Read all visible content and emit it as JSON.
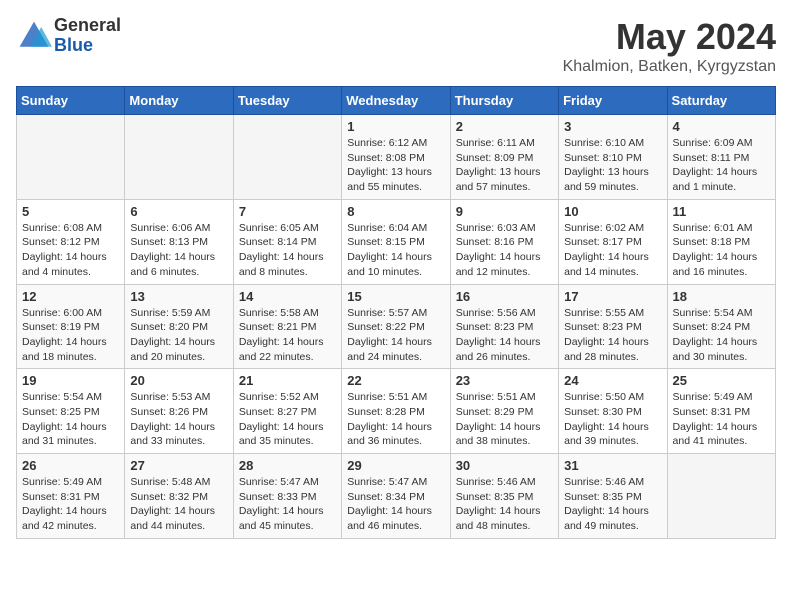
{
  "logo": {
    "general": "General",
    "blue": "Blue"
  },
  "title": {
    "month": "May 2024",
    "location": "Khalmion, Batken, Kyrgyzstan"
  },
  "days": [
    "Sunday",
    "Monday",
    "Tuesday",
    "Wednesday",
    "Thursday",
    "Friday",
    "Saturday"
  ],
  "weeks": [
    [
      {
        "date": "",
        "info": ""
      },
      {
        "date": "",
        "info": ""
      },
      {
        "date": "",
        "info": ""
      },
      {
        "date": "1",
        "info": "Sunrise: 6:12 AM\nSunset: 8:08 PM\nDaylight: 13 hours and 55 minutes."
      },
      {
        "date": "2",
        "info": "Sunrise: 6:11 AM\nSunset: 8:09 PM\nDaylight: 13 hours and 57 minutes."
      },
      {
        "date": "3",
        "info": "Sunrise: 6:10 AM\nSunset: 8:10 PM\nDaylight: 13 hours and 59 minutes."
      },
      {
        "date": "4",
        "info": "Sunrise: 6:09 AM\nSunset: 8:11 PM\nDaylight: 14 hours and 1 minute."
      }
    ],
    [
      {
        "date": "5",
        "info": "Sunrise: 6:08 AM\nSunset: 8:12 PM\nDaylight: 14 hours and 4 minutes."
      },
      {
        "date": "6",
        "info": "Sunrise: 6:06 AM\nSunset: 8:13 PM\nDaylight: 14 hours and 6 minutes."
      },
      {
        "date": "7",
        "info": "Sunrise: 6:05 AM\nSunset: 8:14 PM\nDaylight: 14 hours and 8 minutes."
      },
      {
        "date": "8",
        "info": "Sunrise: 6:04 AM\nSunset: 8:15 PM\nDaylight: 14 hours and 10 minutes."
      },
      {
        "date": "9",
        "info": "Sunrise: 6:03 AM\nSunset: 8:16 PM\nDaylight: 14 hours and 12 minutes."
      },
      {
        "date": "10",
        "info": "Sunrise: 6:02 AM\nSunset: 8:17 PM\nDaylight: 14 hours and 14 minutes."
      },
      {
        "date": "11",
        "info": "Sunrise: 6:01 AM\nSunset: 8:18 PM\nDaylight: 14 hours and 16 minutes."
      }
    ],
    [
      {
        "date": "12",
        "info": "Sunrise: 6:00 AM\nSunset: 8:19 PM\nDaylight: 14 hours and 18 minutes."
      },
      {
        "date": "13",
        "info": "Sunrise: 5:59 AM\nSunset: 8:20 PM\nDaylight: 14 hours and 20 minutes."
      },
      {
        "date": "14",
        "info": "Sunrise: 5:58 AM\nSunset: 8:21 PM\nDaylight: 14 hours and 22 minutes."
      },
      {
        "date": "15",
        "info": "Sunrise: 5:57 AM\nSunset: 8:22 PM\nDaylight: 14 hours and 24 minutes."
      },
      {
        "date": "16",
        "info": "Sunrise: 5:56 AM\nSunset: 8:23 PM\nDaylight: 14 hours and 26 minutes."
      },
      {
        "date": "17",
        "info": "Sunrise: 5:55 AM\nSunset: 8:23 PM\nDaylight: 14 hours and 28 minutes."
      },
      {
        "date": "18",
        "info": "Sunrise: 5:54 AM\nSunset: 8:24 PM\nDaylight: 14 hours and 30 minutes."
      }
    ],
    [
      {
        "date": "19",
        "info": "Sunrise: 5:54 AM\nSunset: 8:25 PM\nDaylight: 14 hours and 31 minutes."
      },
      {
        "date": "20",
        "info": "Sunrise: 5:53 AM\nSunset: 8:26 PM\nDaylight: 14 hours and 33 minutes."
      },
      {
        "date": "21",
        "info": "Sunrise: 5:52 AM\nSunset: 8:27 PM\nDaylight: 14 hours and 35 minutes."
      },
      {
        "date": "22",
        "info": "Sunrise: 5:51 AM\nSunset: 8:28 PM\nDaylight: 14 hours and 36 minutes."
      },
      {
        "date": "23",
        "info": "Sunrise: 5:51 AM\nSunset: 8:29 PM\nDaylight: 14 hours and 38 minutes."
      },
      {
        "date": "24",
        "info": "Sunrise: 5:50 AM\nSunset: 8:30 PM\nDaylight: 14 hours and 39 minutes."
      },
      {
        "date": "25",
        "info": "Sunrise: 5:49 AM\nSunset: 8:31 PM\nDaylight: 14 hours and 41 minutes."
      }
    ],
    [
      {
        "date": "26",
        "info": "Sunrise: 5:49 AM\nSunset: 8:31 PM\nDaylight: 14 hours and 42 minutes."
      },
      {
        "date": "27",
        "info": "Sunrise: 5:48 AM\nSunset: 8:32 PM\nDaylight: 14 hours and 44 minutes."
      },
      {
        "date": "28",
        "info": "Sunrise: 5:47 AM\nSunset: 8:33 PM\nDaylight: 14 hours and 45 minutes."
      },
      {
        "date": "29",
        "info": "Sunrise: 5:47 AM\nSunset: 8:34 PM\nDaylight: 14 hours and 46 minutes."
      },
      {
        "date": "30",
        "info": "Sunrise: 5:46 AM\nSunset: 8:35 PM\nDaylight: 14 hours and 48 minutes."
      },
      {
        "date": "31",
        "info": "Sunrise: 5:46 AM\nSunset: 8:35 PM\nDaylight: 14 hours and 49 minutes."
      },
      {
        "date": "",
        "info": ""
      }
    ]
  ]
}
